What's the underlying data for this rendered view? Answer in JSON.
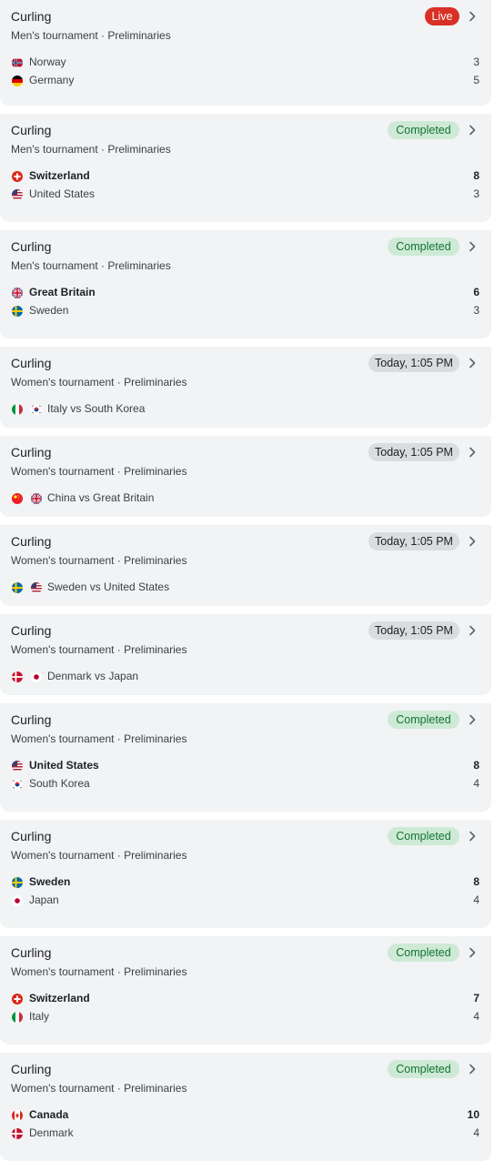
{
  "events": [
    {
      "sport": "Curling",
      "subtitle": "Men's tournament · Preliminaries",
      "status": "live",
      "badge": "Live",
      "teams": [
        {
          "name": "Norway",
          "flag": "norway",
          "score": "3",
          "winner": false
        },
        {
          "name": "Germany",
          "flag": "germany",
          "score": "5",
          "winner": false
        }
      ]
    },
    {
      "sport": "Curling",
      "subtitle": "Men's tournament · Preliminaries",
      "status": "completed",
      "badge": "Completed",
      "teams": [
        {
          "name": "Switzerland",
          "flag": "switzerland",
          "score": "8",
          "winner": true
        },
        {
          "name": "United States",
          "flag": "united-states",
          "score": "3",
          "winner": false
        }
      ]
    },
    {
      "sport": "Curling",
      "subtitle": "Men's tournament · Preliminaries",
      "status": "completed",
      "badge": "Completed",
      "teams": [
        {
          "name": "Great Britain",
          "flag": "great-britain",
          "score": "6",
          "winner": true
        },
        {
          "name": "Sweden",
          "flag": "sweden",
          "score": "3",
          "winner": false
        }
      ]
    },
    {
      "sport": "Curling",
      "subtitle": "Women's tournament · Preliminaries",
      "status": "scheduled",
      "badge": "Today, 1:05 PM",
      "matchup": "Italy vs South Korea",
      "flags": [
        "italy",
        "south-korea"
      ]
    },
    {
      "sport": "Curling",
      "subtitle": "Women's tournament · Preliminaries",
      "status": "scheduled",
      "badge": "Today, 1:05 PM",
      "matchup": "China vs Great Britain",
      "flags": [
        "china",
        "great-britain"
      ]
    },
    {
      "sport": "Curling",
      "subtitle": "Women's tournament · Preliminaries",
      "status": "scheduled",
      "badge": "Today, 1:05 PM",
      "matchup": "Sweden vs United States",
      "flags": [
        "sweden",
        "united-states"
      ]
    },
    {
      "sport": "Curling",
      "subtitle": "Women's tournament · Preliminaries",
      "status": "scheduled",
      "badge": "Today, 1:05 PM",
      "matchup": "Denmark vs Japan",
      "flags": [
        "denmark",
        "japan"
      ]
    },
    {
      "sport": "Curling",
      "subtitle": "Women's tournament · Preliminaries",
      "status": "completed",
      "badge": "Completed",
      "teams": [
        {
          "name": "United States",
          "flag": "united-states",
          "score": "8",
          "winner": true
        },
        {
          "name": "South Korea",
          "flag": "south-korea",
          "score": "4",
          "winner": false
        }
      ]
    },
    {
      "sport": "Curling",
      "subtitle": "Women's tournament · Preliminaries",
      "status": "completed",
      "badge": "Completed",
      "teams": [
        {
          "name": "Sweden",
          "flag": "sweden",
          "score": "8",
          "winner": true
        },
        {
          "name": "Japan",
          "flag": "japan",
          "score": "4",
          "winner": false
        }
      ]
    },
    {
      "sport": "Curling",
      "subtitle": "Women's tournament · Preliminaries",
      "status": "completed",
      "badge": "Completed",
      "teams": [
        {
          "name": "Switzerland",
          "flag": "switzerland",
          "score": "7",
          "winner": true
        },
        {
          "name": "Italy",
          "flag": "italy",
          "score": "4",
          "winner": false
        }
      ]
    },
    {
      "sport": "Curling",
      "subtitle": "Women's tournament · Preliminaries",
      "status": "completed",
      "badge": "Completed",
      "teams": [
        {
          "name": "Canada",
          "flag": "canada",
          "score": "10",
          "winner": true
        },
        {
          "name": "Denmark",
          "flag": "denmark",
          "score": "4",
          "winner": false
        }
      ]
    }
  ],
  "colors": {
    "card_bg": "#f1f3f4",
    "live": "#d93025",
    "completed_bg": "#ceead6",
    "completed_text": "#137333",
    "scheduled_bg": "#dadce0"
  }
}
